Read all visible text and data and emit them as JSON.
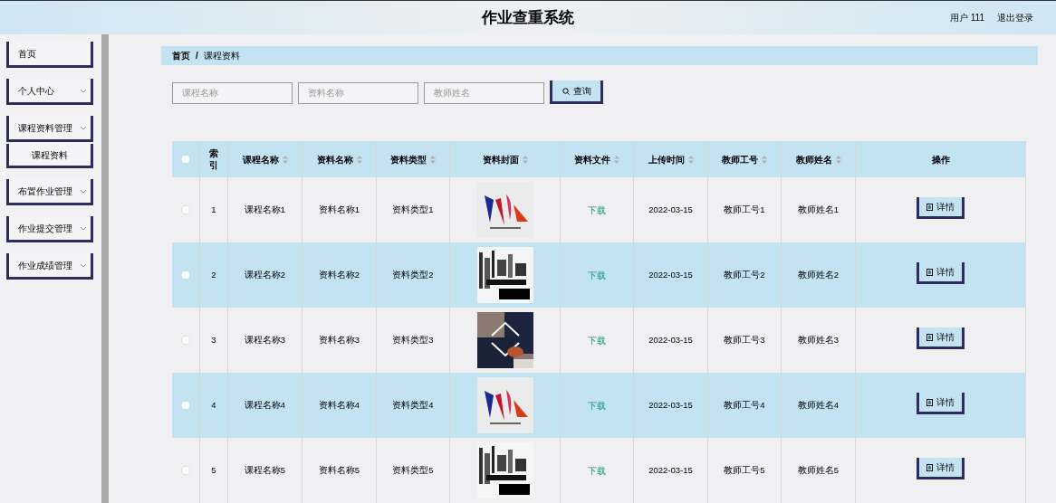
{
  "header": {
    "title": "作业查重系统",
    "user": "用户 111",
    "logout": "退出登录"
  },
  "sidebar": {
    "items": [
      {
        "label": "首页",
        "kind": "link"
      },
      {
        "label": "个人中心",
        "kind": "menu"
      },
      {
        "label": "课程资料管理",
        "kind": "menu",
        "children": [
          {
            "label": "课程资料"
          }
        ]
      },
      {
        "label": "布置作业管理",
        "kind": "menu"
      },
      {
        "label": "作业提交管理",
        "kind": "menu"
      },
      {
        "label": "作业成绩管理",
        "kind": "menu"
      }
    ]
  },
  "breadcrumb": {
    "items": [
      "首页",
      "课程资料"
    ],
    "separator": "/"
  },
  "search": {
    "fields": [
      {
        "placeholder": "课程名称"
      },
      {
        "placeholder": "资料名称"
      },
      {
        "placeholder": "教师姓名"
      }
    ],
    "button": "查询"
  },
  "table": {
    "columns": [
      {
        "label": "索引",
        "sortable": false
      },
      {
        "label": "课程名称",
        "sortable": true
      },
      {
        "label": "资料名称",
        "sortable": true
      },
      {
        "label": "资料类型",
        "sortable": true
      },
      {
        "label": "资料封面",
        "sortable": true
      },
      {
        "label": "资料文件",
        "sortable": true
      },
      {
        "label": "上传时间",
        "sortable": true
      },
      {
        "label": "教师工号",
        "sortable": true
      },
      {
        "label": "教师姓名",
        "sortable": true
      },
      {
        "label": "操作",
        "sortable": false
      }
    ],
    "select_all_checked": false,
    "rows": [
      {
        "index": "1",
        "course": "课程名称1",
        "name": "资料名称1",
        "type": "资料类型1",
        "file": "下载",
        "time": "2022-03-15",
        "teacher_id": "教师工号1",
        "teacher": "教师姓名1",
        "action": "详情",
        "checked": false
      },
      {
        "index": "2",
        "course": "课程名称2",
        "name": "资料名称2",
        "type": "资料类型2",
        "file": "下载",
        "time": "2022-03-15",
        "teacher_id": "教师工号2",
        "teacher": "教师姓名2",
        "action": "详情",
        "checked": false
      },
      {
        "index": "3",
        "course": "课程名称3",
        "name": "资料名称3",
        "type": "资料类型3",
        "file": "下载",
        "time": "2022-03-15",
        "teacher_id": "教师工号3",
        "teacher": "教师姓名3",
        "action": "详情",
        "checked": false
      },
      {
        "index": "4",
        "course": "课程名称4",
        "name": "资料名称4",
        "type": "资料类型4",
        "file": "下载",
        "time": "2022-03-15",
        "teacher_id": "教师工号4",
        "teacher": "教师姓名4",
        "action": "详情",
        "checked": false
      },
      {
        "index": "5",
        "course": "课程名称5",
        "name": "资料名称5",
        "type": "资料类型5",
        "file": "下载",
        "time": "2022-03-15",
        "teacher_id": "教师工号5",
        "teacher": "教师姓名5",
        "action": "详情",
        "checked": false
      }
    ]
  }
}
